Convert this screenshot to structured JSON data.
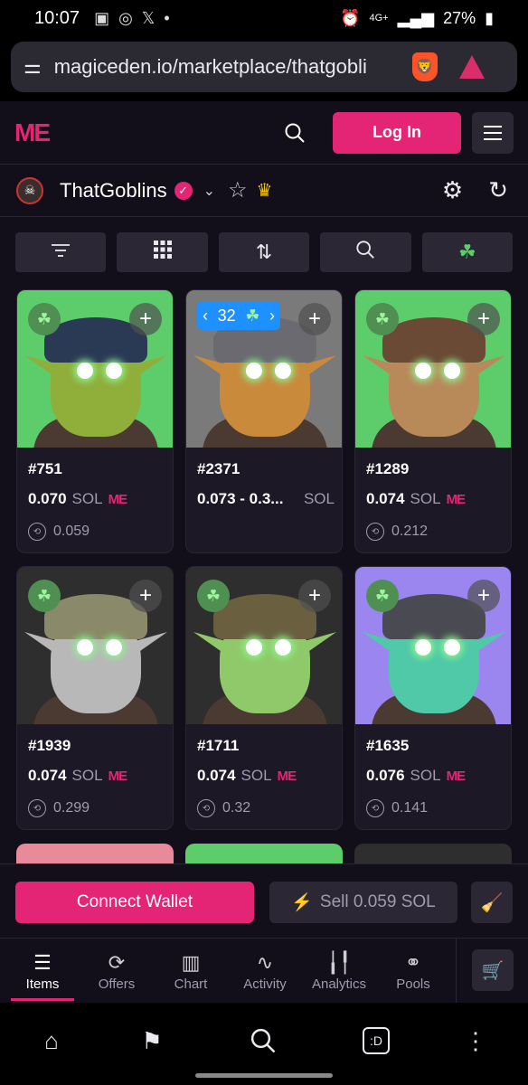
{
  "status": {
    "time": "10:07",
    "battery": "27%",
    "network": "4G+"
  },
  "browser": {
    "url": "magiceden.io/marketplace/thatgobli"
  },
  "header": {
    "logo": "ME",
    "login_label": "Log In"
  },
  "collection": {
    "name": "ThatGoblins"
  },
  "toolbar": {
    "icons": [
      "filter-icon",
      "grid-icon",
      "sort-icon",
      "search-icon",
      "clover-icon"
    ]
  },
  "cards": [
    {
      "name": "#751",
      "price": "0.070",
      "unit": "SOL",
      "last": "0.059",
      "bg": "#5dcc6b",
      "skin": "#8fae3a",
      "hat": "#2a3a55"
    },
    {
      "name": "#2371",
      "price": "0.073 - 0.3...",
      "unit": "SOL",
      "last": "",
      "bg": "#7a7a7a",
      "skin": "#c98a3c",
      "hat": "#6a6a70",
      "bundle_count": "32"
    },
    {
      "name": "#1289",
      "price": "0.074",
      "unit": "SOL",
      "last": "0.212",
      "bg": "#5dcc6b",
      "skin": "#b88a5a",
      "hat": "#6b4a35"
    },
    {
      "name": "#1939",
      "price": "0.074",
      "unit": "SOL",
      "last": "0.299",
      "bg": "#2e2e2e",
      "skin": "#b8b8b8",
      "hat": "#8a8a6a"
    },
    {
      "name": "#1711",
      "price": "0.074",
      "unit": "SOL",
      "last": "0.32",
      "bg": "#2e2e2e",
      "skin": "#8fc96a",
      "hat": "#6a6040"
    },
    {
      "name": "#1635",
      "price": "0.076",
      "unit": "SOL",
      "last": "0.141",
      "bg": "#9b86f0",
      "skin": "#4fc9a8",
      "hat": "#4a4a52"
    }
  ],
  "actions": {
    "connect_label": "Connect Wallet",
    "sell_label": "Sell 0.059 SOL"
  },
  "tabs": [
    {
      "label": "Items",
      "icon": "items-icon"
    },
    {
      "label": "Offers",
      "icon": "offers-icon"
    },
    {
      "label": "Chart",
      "icon": "chart-icon"
    },
    {
      "label": "Activity",
      "icon": "activity-icon"
    },
    {
      "label": "Analytics",
      "icon": "analytics-icon"
    },
    {
      "label": "Pools",
      "icon": "pools-icon"
    }
  ],
  "colors": {
    "accent": "#e42575",
    "bg": "#120f1a",
    "card": "#1c1826"
  }
}
